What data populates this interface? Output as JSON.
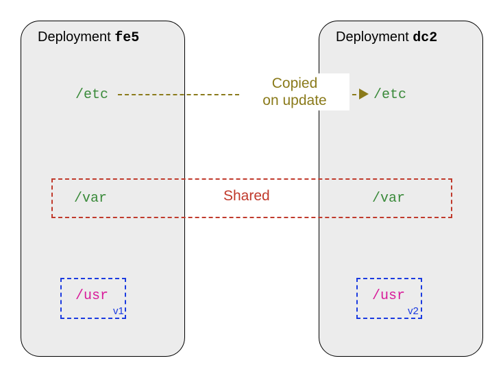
{
  "deployments": {
    "left": {
      "title_prefix": "Deployment ",
      "title_code": "fe5",
      "etc_path": "/etc",
      "var_path": "/var",
      "usr_path": "/usr",
      "usr_version": "v1"
    },
    "right": {
      "title_prefix": "Deployment ",
      "title_code": "dc2",
      "etc_path": "/etc",
      "var_path": "/var",
      "usr_path": "/usr",
      "usr_version": "v2"
    }
  },
  "labels": {
    "copied_line1": "Copied",
    "copied_line2": "on update",
    "shared": "Shared"
  },
  "colors": {
    "box_bg": "#ececec",
    "path_green": "#3a8a3a",
    "arrow_olive": "#8a7a1a",
    "shared_red": "#c0392b",
    "usr_blue": "#1a3ae0",
    "usr_magenta": "#d81b9a"
  }
}
